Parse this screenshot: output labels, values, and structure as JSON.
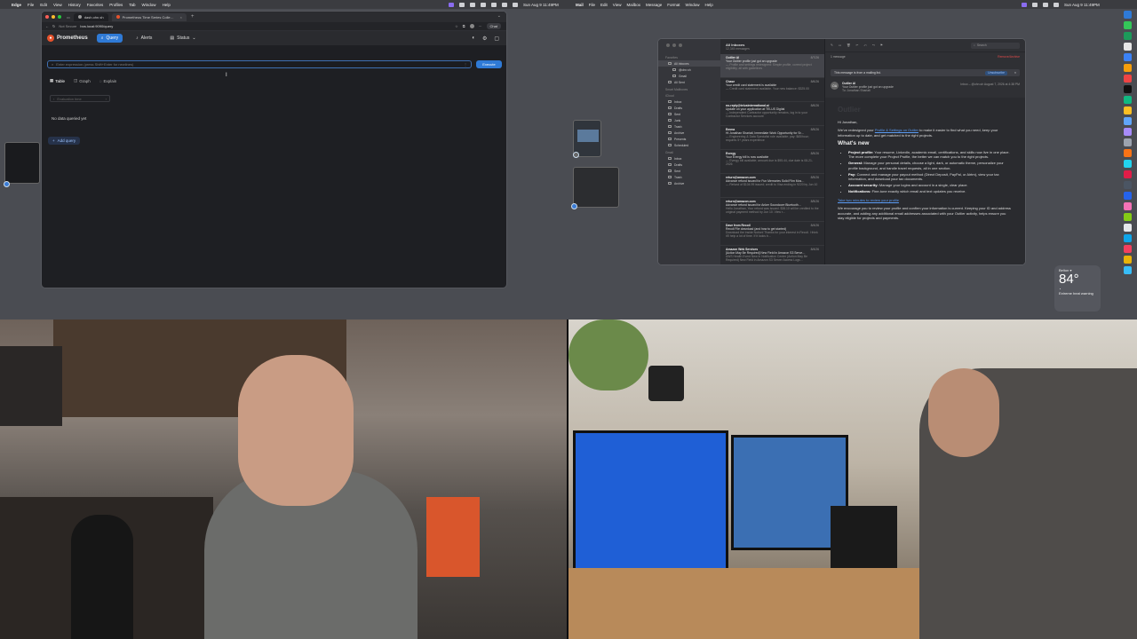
{
  "menubar": {
    "app": "Edge",
    "items": [
      "File",
      "Edit",
      "View",
      "History",
      "Favorites",
      "Profiles",
      "Tab",
      "Window",
      "Help"
    ],
    "clock": "Sun Aug 9 11:49PM",
    "right_items": [
      "Mail",
      "File",
      "Edit",
      "View",
      "Mailbox",
      "Message",
      "Format",
      "Window",
      "Help"
    ],
    "clock2": "Sun Aug 9 11:49PM"
  },
  "browser": {
    "tabs": [
      {
        "label": "dash.ohn.sh",
        "active": false
      },
      {
        "label": "Prometheus Time Series Colle…",
        "active": true
      }
    ],
    "address": {
      "security": "Not Secure",
      "url": "bos.local:9090/query"
    },
    "chat_label": "Chat",
    "prometheus": {
      "brand": "Prometheus",
      "nav": [
        {
          "label": "Query",
          "active": true
        },
        {
          "label": "Alerts",
          "active": false
        },
        {
          "label": "Status",
          "active": false
        }
      ],
      "query_placeholder": "Enter expression (press Shift+Enter for newlines)",
      "execute_label": "Execute",
      "view_tabs": [
        "Table",
        "Graph",
        "Explain"
      ],
      "eval_time_placeholder": "Evaluation time",
      "no_data": "No data queried yet",
      "add_query": "Add query"
    }
  },
  "mail": {
    "sidebar": {
      "favorites_label": "Favorites",
      "favorites": [
        {
          "label": "All Inboxes",
          "sub": false,
          "selected": true
        },
        {
          "label": "@ohn.sh",
          "sub": true,
          "selected": false
        },
        {
          "label": "Gmail",
          "sub": true,
          "selected": false
        },
        {
          "label": "All Sent",
          "sub": false,
          "selected": false
        }
      ],
      "smart_label": "Smart Mailboxes",
      "icloud_label": "iCloud",
      "icloud": [
        "Inbox",
        "Drafts",
        "Sent",
        "Junk",
        "Trash",
        "Archive",
        "Presents",
        "Scheduled"
      ],
      "gmail_label": "Gmail",
      "gmail": [
        "Inbox",
        "Drafts",
        "Sent",
        "Trash",
        "Archive"
      ]
    },
    "list": {
      "title": "All Inboxes",
      "count": "12,345 messages",
      "rows": [
        {
          "from": "Outlier AI",
          "time": "8/7/26",
          "subject": "Your Outlier profile just got an upgrade",
          "preview": "— Profile and settings redesigned: Simple profile, correct project eligibility, all with guidelines",
          "selected": true
        },
        {
          "from": "Chase",
          "time": "8/6/26",
          "subject": "Your credit card statement is available",
          "preview": "— Credit card statement available. Your new balance: $325.00",
          "selected": false
        },
        {
          "from": "no-reply@telusinternational.ai",
          "time": "8/6/26",
          "subject": "Update on your application at TELUS Digital",
          "preview": "— Independent Contractor opportunity remains, log in to your Contractor Services account",
          "selected": false
        },
        {
          "from": "Emma",
          "time": "8/5/26",
          "subject": "Hi Jonathan Shariati, Immediate Work Opportunity for Sr…",
          "preview": "— Engineering & Data Specialist role available; pay: $65/hour; requires 5+ years experience",
          "selected": false
        },
        {
          "from": "Evergy",
          "time": "8/5/26",
          "subject": "Your Evergy bill is now available",
          "preview": "— Evergy bill available; amount due is $95.44, due date is 08-21-2026",
          "selected": false
        },
        {
          "from": "return@amazon.com",
          "time": "8/5/26",
          "subject": "Advance refund issued for Fun Memories Solid Film Mos…",
          "preview": "— Refund of $104.99 issued; credit to Visa ending in 9220 by Jun 10",
          "selected": false
        },
        {
          "from": "return@amazon.com",
          "time": "8/5/26",
          "subject": "Advance refund issued for Anker Soundcore Bluetooth…",
          "preview": "Hello Jonathan, Your refund was issued. $38.10 will be credited to the original payment method by Jun 10. View r…",
          "selected": false
        },
        {
          "from": "Dave from Recoil",
          "time": "8/4/26",
          "subject": "Recoil File download (and how to get started)",
          "preview": "Download the Inside Notion! Thanks for your interest in Recoil. I think it'll help a lot of time. If it looks b…",
          "selected": false
        },
        {
          "from": "Amazon Web Services",
          "time": "8/4/26",
          "subject": "[Action May Be Required] New Field in Amazon S3 Serve…",
          "preview": "AWS Health Event New in Notification Center (Action May Be Required) New Field in Amazon S3 Server Access Logs…",
          "selected": false
        }
      ]
    },
    "reader": {
      "search_placeholder": "Search",
      "folder": "1 message",
      "remove_label": "Remove/Archive",
      "banner": "This message is from a mailing list.",
      "unsubscribe": "Unsubscribe",
      "avatar": "OA",
      "from": "Outlier AI",
      "subject": "Your Outlier profile just got an upgrade",
      "to": "To:  Jonathan Shariati",
      "meta": "Inbox – @ohn.sh   August 7, 2026 at 4:38 PM",
      "logo": "Outlier",
      "greeting": "Hi Jonathan,",
      "intro_pre": "We've redesigned your ",
      "intro_link": "Profile & Settings on Outlier",
      "intro_post": " to make it easier to find what you need, keep your information up to date, and get matched to the right projects.",
      "heading": "What's new",
      "bullets": [
        {
          "label": "Project profile:",
          "text": " Your resume, LinkedIn, academic email, certifications, and skills now live in one place. The more complete your Project Profile, the better we can match you to the right projects."
        },
        {
          "label": "General:",
          "text": " Manage your personal details, choose a light, dark, or automatic theme, personalize your profile background, and handle travel requests, all in one section."
        },
        {
          "label": "Pay:",
          "text": " Connect and manage your payout method (Direct Deposit, PayPal, or Airtm), view your tax information, and download your tax documents."
        },
        {
          "label": "Account security:",
          "text": " Manage your logins and account in a single, clear place."
        },
        {
          "label": "Notifications:",
          "text": " Fine-tune exactly which email and text updates you receive."
        }
      ],
      "cta": "Take two minutes to review your profile",
      "closing": "We encourage you to review your profile and confirm your information is current. Keeping your ID and address accurate, and adding any additional email addresses associated with your Outlier activity, helps ensure you stay eligible for projects and payments."
    }
  },
  "weather": {
    "location": "Belton ▾",
    "temp": "84°",
    "condition": "Extreme heat warning"
  },
  "colors": {
    "accent": "#2f7ad6",
    "prometheus": "#e6522c"
  }
}
